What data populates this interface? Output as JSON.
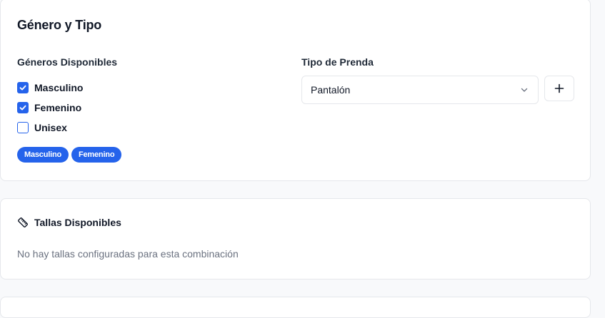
{
  "section_gender_type": {
    "title": "Género y Tipo",
    "genders_label": "Géneros Disponibles",
    "genders": [
      {
        "label": "Masculino",
        "checked": true
      },
      {
        "label": "Femenino",
        "checked": true
      },
      {
        "label": "Unisex",
        "checked": false
      }
    ],
    "selected_badges": [
      "Masculino",
      "Femenino"
    ],
    "type_label": "Tipo de Prenda",
    "type_value": "Pantalón",
    "add_button_icon": "plus-icon",
    "select_icon": "chevron-down-icon"
  },
  "section_sizes": {
    "icon": "ruler-icon",
    "title": "Tallas Disponibles",
    "empty_message": "No hay tallas configuradas para esta combinación"
  },
  "colors": {
    "accent": "#2563eb",
    "border": "#e5e7eb",
    "muted_text": "#6b7280",
    "background": "#f8f9fb"
  }
}
